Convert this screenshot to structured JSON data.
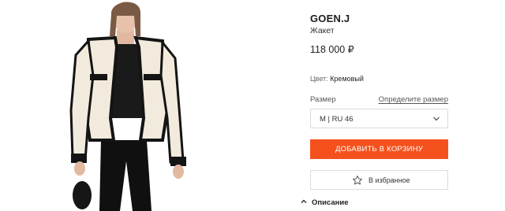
{
  "product": {
    "brand": "GOEN.J",
    "subtitle": "Жакет",
    "price": "118 000 ₽"
  },
  "color": {
    "label": "Цвет:",
    "value": "Кремовый"
  },
  "size": {
    "label": "Размер",
    "link": "Определите размер",
    "selected": "M | RU 46"
  },
  "actions": {
    "add_to_cart": "ДОБАВИТЬ В КОРЗИНУ",
    "favorite": "В избранное"
  },
  "description": {
    "label": "Описание"
  },
  "colors": {
    "accent": "#f4511e",
    "jacket": "#f2ebdd",
    "trim": "#141414"
  },
  "icons": {
    "size_dropdown": "chevron-down-icon",
    "favorite": "star-outline-icon",
    "description_toggle": "chevron-up-icon"
  }
}
